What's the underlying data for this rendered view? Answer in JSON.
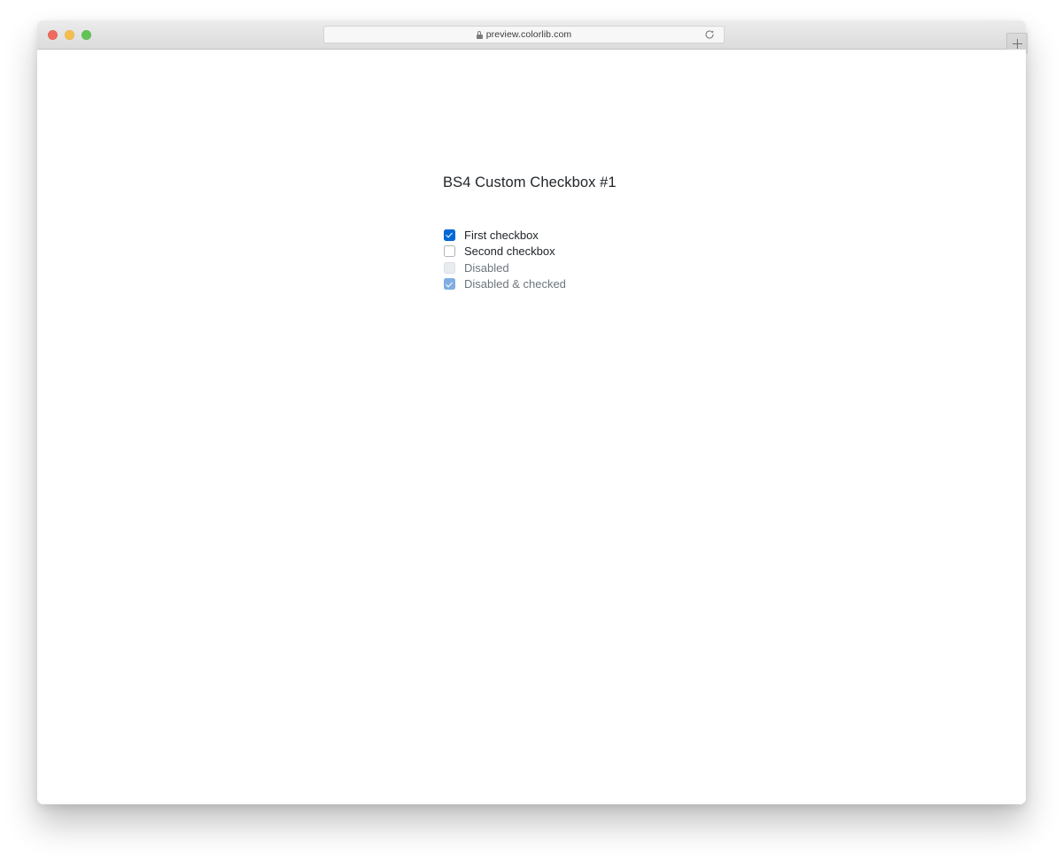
{
  "browser": {
    "traffic_lights": [
      {
        "name": "close",
        "color": "#ee6a5f"
      },
      {
        "name": "minimize",
        "color": "#f5bd4f"
      },
      {
        "name": "zoom",
        "color": "#61c454"
      }
    ],
    "address_bar": {
      "url": "preview.colorlib.com",
      "lock_icon": "lock-icon",
      "reload_icon": "reload-icon"
    },
    "new_tab_icon": "plus-icon"
  },
  "page": {
    "title": "BS4 Custom Checkbox #1",
    "accent_color": "#0069d9",
    "muted_color": "#6c757d",
    "checkboxes": [
      {
        "label": "First checkbox",
        "checked": true,
        "disabled": false
      },
      {
        "label": "Second checkbox",
        "checked": false,
        "disabled": false
      },
      {
        "label": "Disabled",
        "checked": false,
        "disabled": true
      },
      {
        "label": "Disabled & checked",
        "checked": true,
        "disabled": true
      }
    ]
  }
}
